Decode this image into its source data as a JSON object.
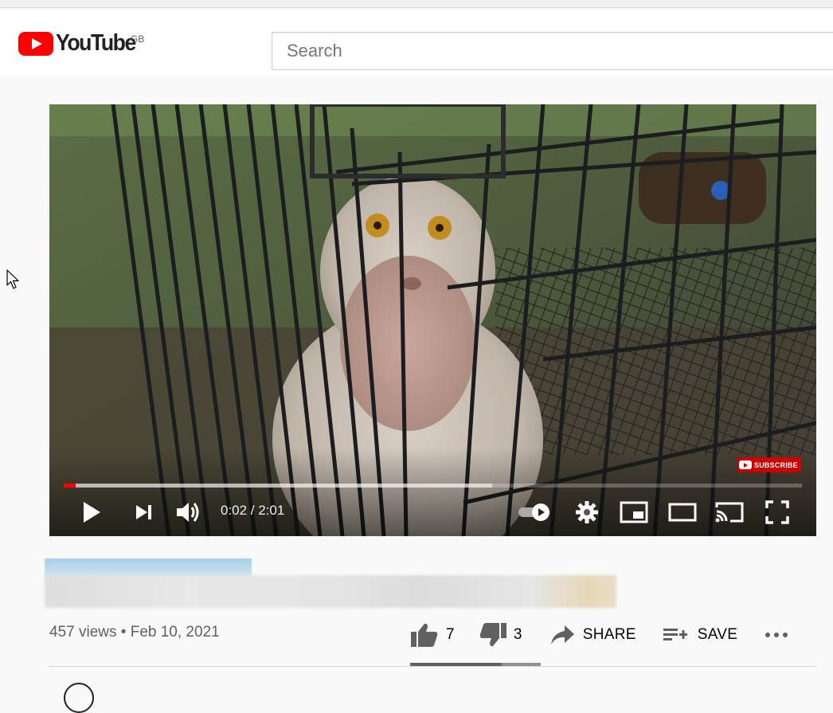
{
  "header": {
    "logo_text": "YouTube",
    "region": "GB",
    "search_placeholder": "Search"
  },
  "player": {
    "current_time": "0:02",
    "duration": "2:01",
    "time_display": "0:02 / 2:01",
    "progress_played": 0.0165,
    "progress_buffered": 0.58,
    "subscribe_badge": "SUBSCRIBE",
    "autoplay_on": true
  },
  "video": {
    "views": "457 views",
    "date": "Feb 10, 2021",
    "meta_line": "457 views • Feb 10, 2021",
    "likes": "7",
    "dislikes": "3",
    "share_label": "SHARE",
    "save_label": "SAVE",
    "like_ratio": 0.7
  },
  "colors": {
    "brand_red": "#ff0000",
    "background": "#f9f9f9",
    "text_secondary": "#606060"
  },
  "icons": [
    "youtube-logo-icon",
    "play-icon",
    "next-icon",
    "volume-icon",
    "autoplay-toggle-icon",
    "settings-gear-icon",
    "miniplayer-icon",
    "theater-mode-icon",
    "cast-icon",
    "fullscreen-icon",
    "thumbs-up-icon",
    "thumbs-down-icon",
    "share-arrow-icon",
    "save-playlist-icon",
    "more-icon",
    "mouse-cursor-icon"
  ]
}
